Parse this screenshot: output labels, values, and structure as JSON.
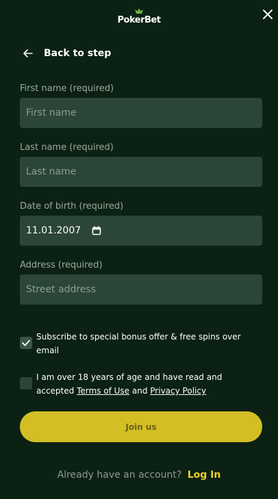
{
  "brand": {
    "name": "PokerBet"
  },
  "nav": {
    "back_label": "Back to step"
  },
  "form": {
    "first_name": {
      "label": "First name (required)",
      "placeholder": "First name"
    },
    "last_name": {
      "label": "Last name (required)",
      "placeholder": "Last name"
    },
    "dob": {
      "label": "Date of birth (required)",
      "value": "11.01.2007"
    },
    "address": {
      "label": "Address (required)",
      "placeholder": "Street address"
    }
  },
  "consents": {
    "subscribe": {
      "checked": true,
      "text": "Subscribe to special bonus offer & free spins over email"
    },
    "age": {
      "checked": false,
      "text_prefix": "I am over 18 years of age and have read and accepted",
      "terms_link": "Terms of Use",
      "and_text": "and",
      "privacy_link": "Privacy Policy"
    }
  },
  "actions": {
    "join_label": "Join us"
  },
  "footer": {
    "prompt": "Already have an account?",
    "login_label": "Log In"
  },
  "colors": {
    "background": "#0b2113",
    "field_bg": "#2b4536",
    "accent": "#d3be26",
    "link_accent": "#f2d22a"
  },
  "icons": [
    "logo-icon",
    "close-icon",
    "back-arrow-icon",
    "calendar-icon",
    "checkmark-icon"
  ]
}
